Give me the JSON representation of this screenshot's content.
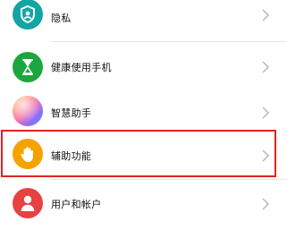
{
  "settings": {
    "items": [
      {
        "label": "隐私",
        "icon": "privacy-shield-icon",
        "color": "#13a5a5"
      },
      {
        "label": "健康使用手机",
        "icon": "hourglass-icon",
        "color": "#1ca63e"
      },
      {
        "label": "智慧助手",
        "icon": "smart-assistant-orb-icon",
        "color": "#ff6a9c"
      },
      {
        "label": "辅助功能",
        "icon": "hand-icon",
        "color": "#f5a200"
      },
      {
        "label": "用户和帐户",
        "icon": "user-icon",
        "color": "#e84141"
      }
    ],
    "highlight_color": "#e02424"
  }
}
